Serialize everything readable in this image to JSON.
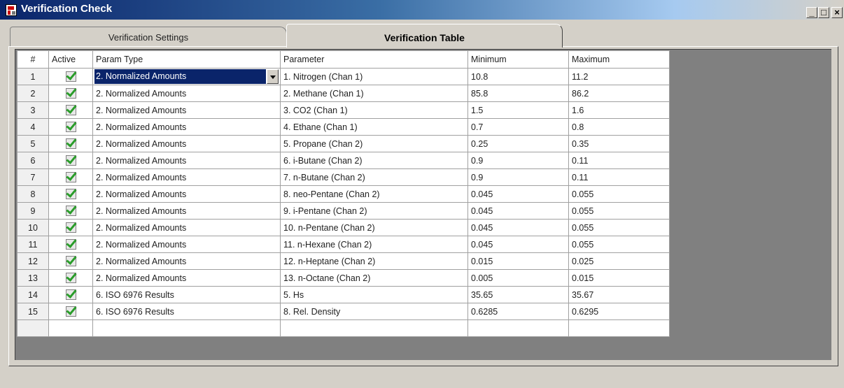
{
  "window": {
    "title": "Verification Check",
    "controls": {
      "minimize": "_",
      "maximize": "□",
      "close": "×"
    }
  },
  "tabs": [
    {
      "label": "Verification Settings",
      "selected": false
    },
    {
      "label": "Verification Table",
      "selected": true
    }
  ],
  "table": {
    "columns": [
      "#",
      "Active",
      "Param Type",
      "Parameter",
      "Minimum",
      "Maximum"
    ],
    "rows": [
      {
        "num": "1",
        "active": true,
        "param_type": "2. Normalized Amounts",
        "parameter": "1. Nitrogen (Chan 1)",
        "minimum": "10.8",
        "maximum": "11.2"
      },
      {
        "num": "2",
        "active": true,
        "param_type": "2. Normalized Amounts",
        "parameter": "2. Methane (Chan 1)",
        "minimum": "85.8",
        "maximum": "86.2"
      },
      {
        "num": "3",
        "active": true,
        "param_type": "2. Normalized Amounts",
        "parameter": "3. CO2 (Chan 1)",
        "minimum": "1.5",
        "maximum": "1.6"
      },
      {
        "num": "4",
        "active": true,
        "param_type": "2. Normalized Amounts",
        "parameter": "4. Ethane (Chan 1)",
        "minimum": "0.7",
        "maximum": "0.8"
      },
      {
        "num": "5",
        "active": true,
        "param_type": "2. Normalized Amounts",
        "parameter": "5. Propane (Chan 2)",
        "minimum": "0.25",
        "maximum": "0.35"
      },
      {
        "num": "6",
        "active": true,
        "param_type": "2. Normalized Amounts",
        "parameter": "6. i-Butane (Chan 2)",
        "minimum": "0.9",
        "maximum": "0.11"
      },
      {
        "num": "7",
        "active": true,
        "param_type": "2. Normalized Amounts",
        "parameter": "7. n-Butane (Chan 2)",
        "minimum": "0.9",
        "maximum": "0.11"
      },
      {
        "num": "8",
        "active": true,
        "param_type": "2. Normalized Amounts",
        "parameter": "8. neo-Pentane (Chan 2)",
        "minimum": "0.045",
        "maximum": "0.055"
      },
      {
        "num": "9",
        "active": true,
        "param_type": "2. Normalized Amounts",
        "parameter": "9. i-Pentane (Chan 2)",
        "minimum": "0.045",
        "maximum": "0.055"
      },
      {
        "num": "10",
        "active": true,
        "param_type": "2. Normalized Amounts",
        "parameter": "10. n-Pentane (Chan 2)",
        "minimum": "0.045",
        "maximum": "0.055"
      },
      {
        "num": "11",
        "active": true,
        "param_type": "2. Normalized Amounts",
        "parameter": "11. n-Hexane (Chan 2)",
        "minimum": "0.045",
        "maximum": "0.055"
      },
      {
        "num": "12",
        "active": true,
        "param_type": "2. Normalized Amounts",
        "parameter": "12. n-Heptane (Chan 2)",
        "minimum": "0.015",
        "maximum": "0.025"
      },
      {
        "num": "13",
        "active": true,
        "param_type": "2. Normalized Amounts",
        "parameter": "13. n-Octane (Chan 2)",
        "minimum": "0.005",
        "maximum": "0.015"
      },
      {
        "num": "14",
        "active": true,
        "param_type": "6. ISO 6976 Results",
        "parameter": "5. Hs",
        "minimum": "35.65",
        "maximum": "35.67"
      },
      {
        "num": "15",
        "active": true,
        "param_type": "6. ISO 6976 Results",
        "parameter": "8. Rel. Density",
        "minimum": "0.6285",
        "maximum": "0.6295"
      }
    ],
    "selected_row": 0,
    "selected_column": "param_type"
  },
  "colors": {
    "titlebar_start": "#0a246a",
    "selection": "#0a246a",
    "checkmark": "#2a9d2a",
    "face": "#d4d0c8"
  },
  "icons": [
    "app-icon",
    "checkbox-checked-icon",
    "dropdown-arrow-icon"
  ]
}
